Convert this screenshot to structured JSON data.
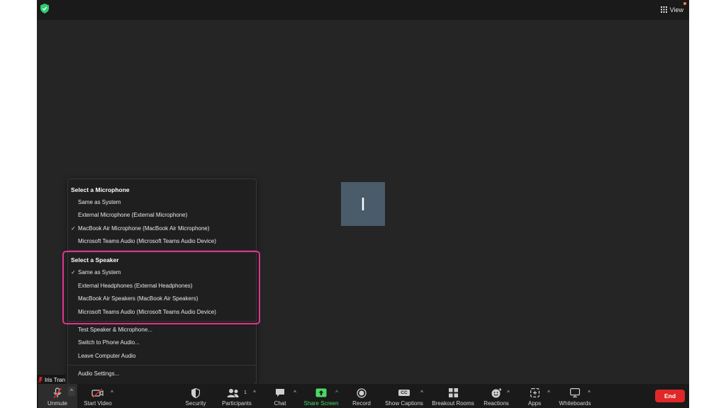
{
  "topbar": {
    "view_label": "View"
  },
  "stage": {
    "avatar_initial": "I",
    "participant_name": "Iris Tran"
  },
  "audio_menu": {
    "microphone_heading": "Select a Microphone",
    "microphones": [
      {
        "label": "Same as System",
        "selected": false
      },
      {
        "label": "External Microphone (External Microphone)",
        "selected": false
      },
      {
        "label": "MacBook Air Microphone (MacBook Air Microphone)",
        "selected": true
      },
      {
        "label": "Microsoft Teams Audio (Microsoft Teams Audio Device)",
        "selected": false
      }
    ],
    "speaker_heading": "Select a Speaker",
    "speakers": [
      {
        "label": "Same as System",
        "selected": true
      },
      {
        "label": "External Headphones (External Headphones)",
        "selected": false
      },
      {
        "label": "MacBook Air Speakers (MacBook Air Speakers)",
        "selected": false
      },
      {
        "label": "Microsoft Teams Audio (Microsoft Teams Audio Device)",
        "selected": false
      }
    ],
    "check_glyph": "✓",
    "actions": {
      "test": "Test Speaker & Microphone...",
      "phone": "Switch to Phone Audio...",
      "leave": "Leave Computer Audio",
      "settings": "Audio Settings..."
    }
  },
  "toolbar": {
    "unmute": "Unmute",
    "start_video": "Start Video",
    "security": "Security",
    "participants": "Participants",
    "participants_count": "1",
    "chat": "Chat",
    "share_screen": "Share Screen",
    "record": "Record",
    "show_captions": "Show Captions",
    "captions_badge": "CC",
    "breakout_rooms": "Breakout Rooms",
    "reactions": "Reactions",
    "apps": "Apps",
    "whiteboards": "Whiteboards",
    "end": "End",
    "caret_glyph": "^"
  },
  "colors": {
    "highlight": "#e0338d",
    "share_green": "#4cd964",
    "end_red": "#e02828",
    "secure_green": "#2ecc71"
  }
}
